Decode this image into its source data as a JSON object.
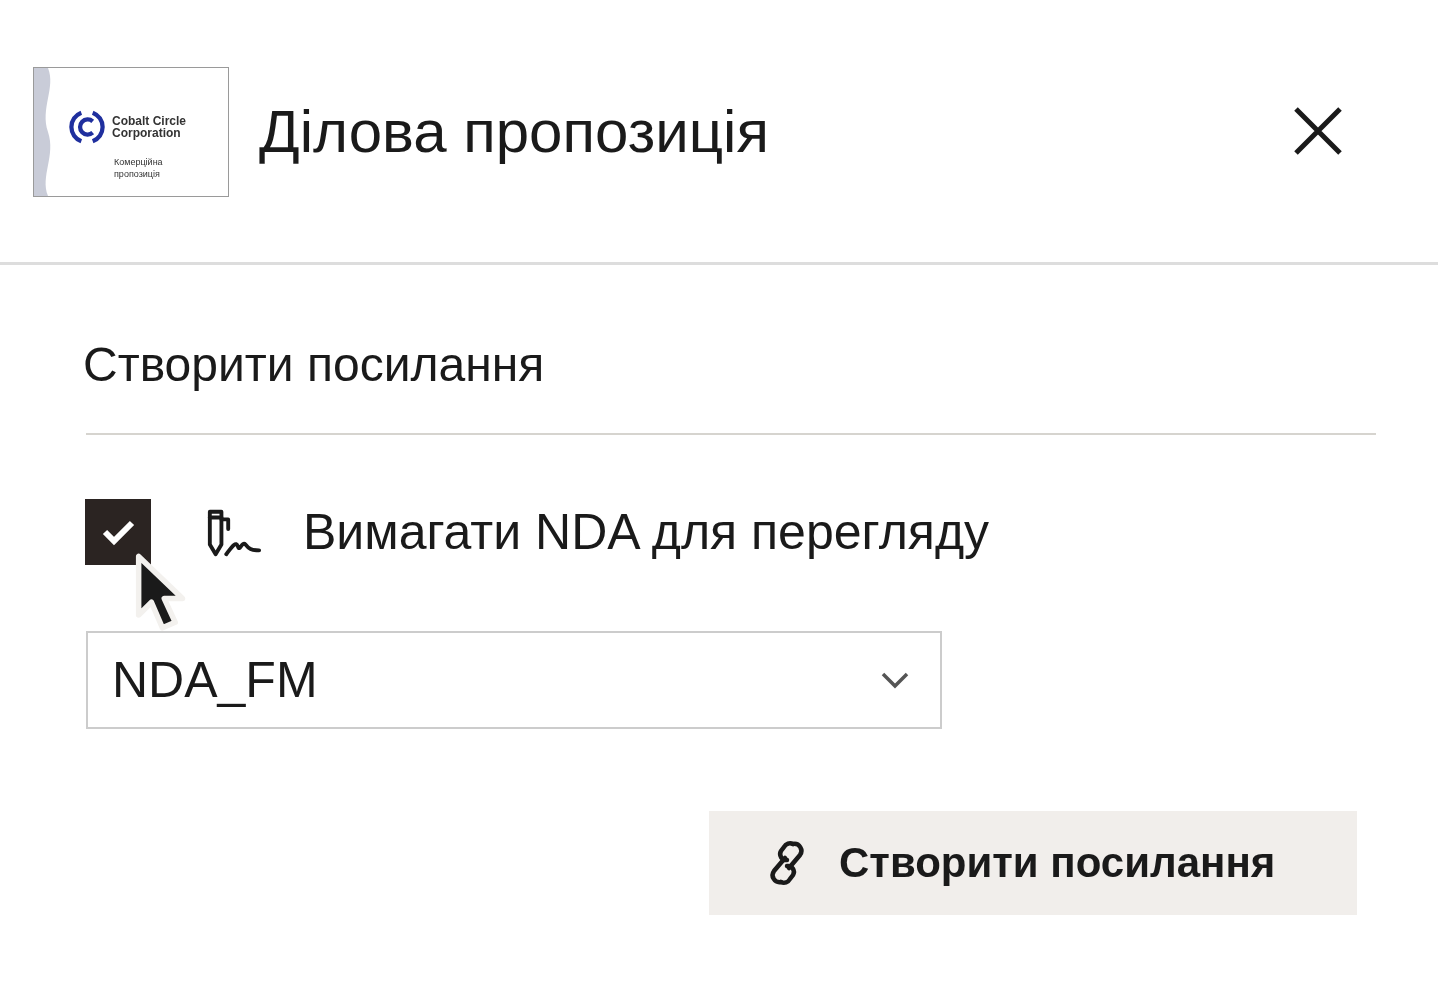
{
  "header": {
    "thumbnail": {
      "company": [
        "Cobalt Circle",
        "Corporation"
      ],
      "subtitle": [
        "Комерційна",
        "пропозиція"
      ]
    },
    "title": "Ділова пропозиція"
  },
  "section": {
    "title": "Створити посилання"
  },
  "nda_option": {
    "checked": true,
    "label": "Вимагати NDA для перегляду"
  },
  "nda_select": {
    "value": "NDA_FM"
  },
  "create_button": {
    "label": "Створити посилання"
  }
}
